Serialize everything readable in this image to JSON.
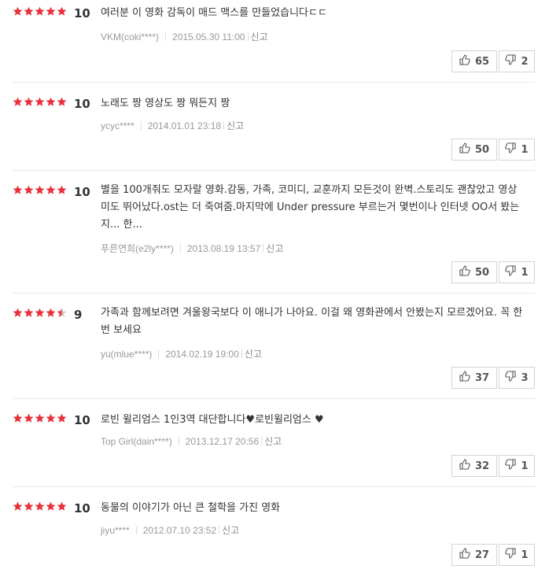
{
  "reviews": [
    {
      "score": "10",
      "rating": 10,
      "text": "여러분 이 영화 감독이 매드 맥스를 만들었습니다ㄷㄷ",
      "user": "VKM(coki****)",
      "date": "2015.05.30 11:00",
      "report": "신고",
      "likes": "65",
      "dislikes": "2"
    },
    {
      "score": "10",
      "rating": 10,
      "text": "노래도 짱 영상도 짱 뭐든지 짱",
      "user": "ycyc****",
      "date": "2014.01.01 23:18",
      "report": "신고",
      "likes": "50",
      "dislikes": "1"
    },
    {
      "score": "10",
      "rating": 10,
      "text": "별을 100개줘도 모자랄 영화.감동, 가족, 코미디, 교훈까지 모든것이 완벽.스토리도 괜찮았고 영상미도 뛰어났다.ost는 더 죽여줌.마지막에 Under pressure 부르는거 몇번이나 인터넷 OO서 봤는지... 한...",
      "user": "푸른연희(e2ly****)",
      "date": "2013.08.19 13:57",
      "report": "신고",
      "likes": "50",
      "dislikes": "1"
    },
    {
      "score": "9",
      "rating": 9,
      "text": "가족과 함께보려면 겨울왕국보다 이 애니가 나아요. 이걸 왜 영화관에서 안봤는지 모르겠어요. 꼭 한 번 보세요",
      "user": "yu(mlue****)",
      "date": "2014.02.19 19:00",
      "report": "신고",
      "likes": "37",
      "dislikes": "3"
    },
    {
      "score": "10",
      "rating": 10,
      "text": "로빈 윌리엄스 1인3역 대단합니다♥로빈윌리엄스 ♥",
      "user": "Top Girl(dain****)",
      "date": "2013.12.17 20:56",
      "report": "신고",
      "likes": "32",
      "dislikes": "1"
    },
    {
      "score": "10",
      "rating": 10,
      "text": "동물의 이야기가 아닌 큰 철학을 가진 영화",
      "user": "jiyu****",
      "date": "2012.07.10 23:52",
      "report": "신고",
      "likes": "27",
      "dislikes": "1"
    }
  ],
  "colors": {
    "star": "#e8313b",
    "star_empty": "#cccccc"
  },
  "icons": {
    "like": "thumbs-up-icon",
    "dislike": "thumbs-down-icon"
  }
}
